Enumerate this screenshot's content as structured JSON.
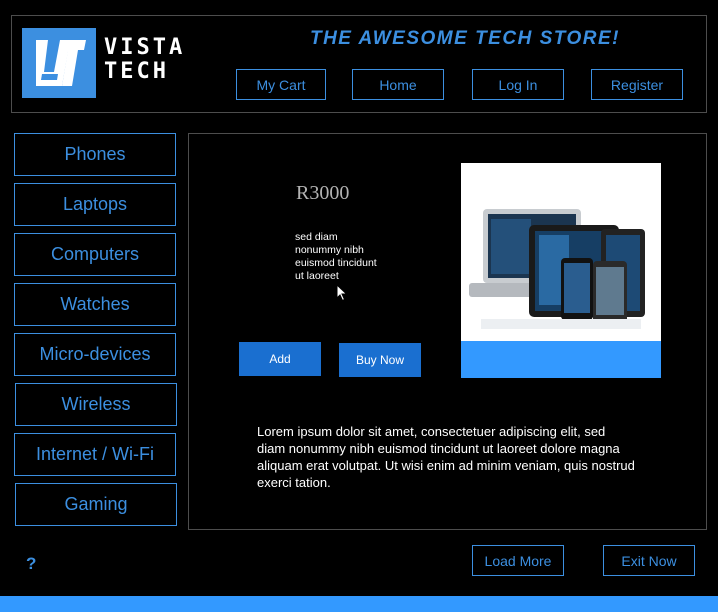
{
  "brand": {
    "logo_line1": "VISTA",
    "logo_line2": "TECH",
    "tagline": "THE AWESOME TECH STORE!"
  },
  "nav": {
    "cart": "My Cart",
    "home": "Home",
    "login": "Log In",
    "register": "Register"
  },
  "sidebar": {
    "items": [
      {
        "label": "Phones"
      },
      {
        "label": "Laptops"
      },
      {
        "label": "Computers"
      },
      {
        "label": "Watches"
      },
      {
        "label": "Micro-devices"
      },
      {
        "label": "Wireless"
      },
      {
        "label": "Internet / Wi-Fi"
      },
      {
        "label": "Gaming"
      }
    ]
  },
  "product": {
    "price": "R3000",
    "short_description": "sed diam nonummy nibh euismod tincidunt ut laoreet",
    "add_label": "Add",
    "buy_label": "Buy Now",
    "long_description": "Lorem ipsum dolor sit amet, consectetuer adipiscing elit, sed diam nonummy nibh euismod tincidunt ut laoreet dolore magna aliquam erat volutpat. Ut wisi enim ad minim  veniam, quis nostrud exerci tation."
  },
  "footer": {
    "help": "?",
    "load_more": "Load More",
    "exit": "Exit Now"
  },
  "colors": {
    "accent": "#3c8fe0",
    "button_fill": "#1a6fd0",
    "bar": "#3399ff",
    "background": "#000000"
  }
}
